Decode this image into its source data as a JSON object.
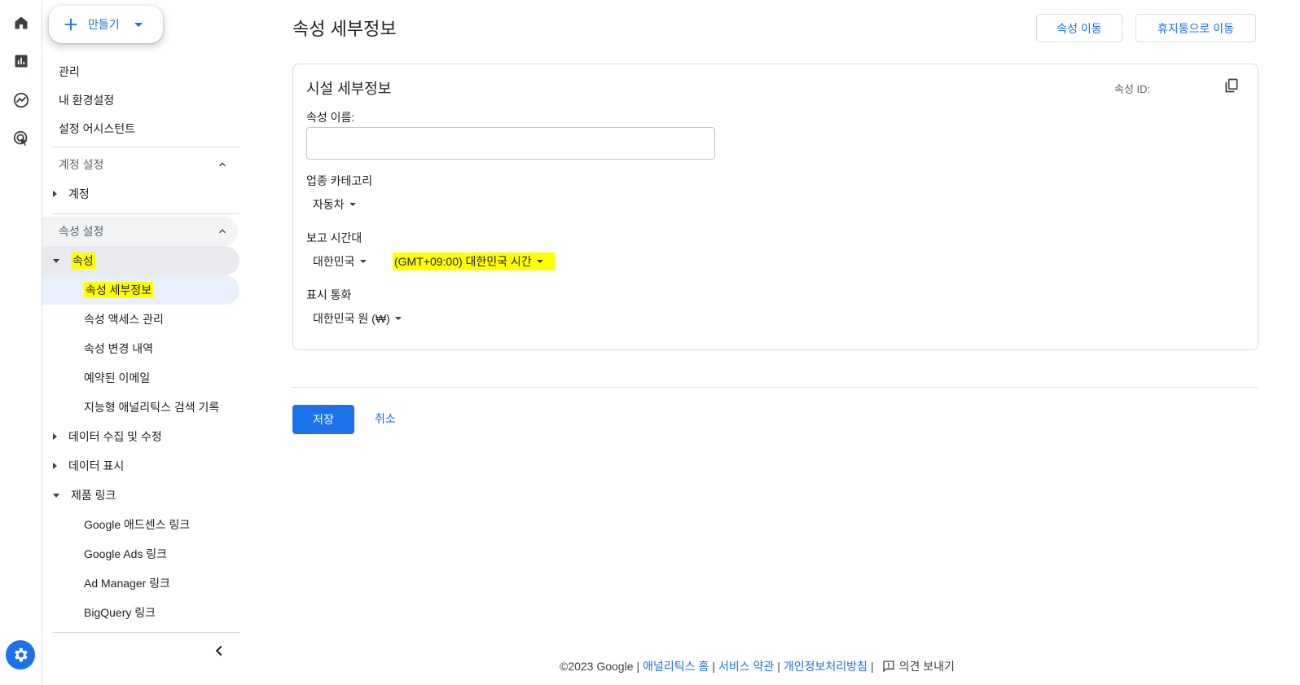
{
  "sidebar": {
    "create_label": "만들기",
    "top_links": [
      "관리",
      "내 환경설정",
      "설정 어시스턴트"
    ],
    "account_section": {
      "label": "계정 설정",
      "item": "계정"
    },
    "property_section": {
      "label": "속성 설정",
      "property_item": "속성",
      "sub_items": [
        "속성 세부정보",
        "속성 액세스 관리",
        "속성 변경 내역",
        "예약된 이메일",
        "지능형 애널리틱스 검색 기록"
      ],
      "data_collection": "데이터 수집 및 수정",
      "data_display": "데이터 표시",
      "product_links": "제품 링크",
      "link_items": [
        "Google 애드센스 링크",
        "Google Ads 링크",
        "Ad Manager 링크",
        "BigQuery 링크"
      ]
    }
  },
  "main": {
    "title": "속성 세부정보",
    "move_property_label": "속성 이동",
    "move_trash_label": "휴지통으로 이동",
    "card": {
      "title": "시설 세부정보",
      "property_id_label": "속성 ID:",
      "name_label": "속성 이름:",
      "name_value": "",
      "industry_label": "업종 카테고리",
      "industry_value": "자동차",
      "timezone_label": "보고 시간대",
      "country_value": "대한민국",
      "timezone_value": "(GMT+09:00) 대한민국 시간",
      "currency_label": "표시 통화",
      "currency_value": "대한민국 원 (₩)"
    },
    "save_label": "저장",
    "cancel_label": "취소"
  },
  "footer": {
    "copyright": "©2023 Google",
    "links": [
      "애널리틱스 홈",
      "서비스 약관",
      "개인정보처리방침"
    ],
    "feedback": "의견 보내기"
  },
  "colors": {
    "accent": "#1a73e8",
    "highlight": "#ffff00"
  }
}
